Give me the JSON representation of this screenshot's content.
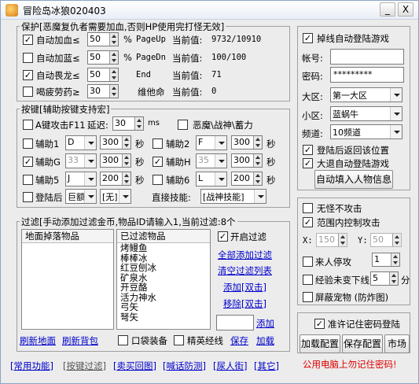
{
  "window": {
    "title": "冒险岛冰狼020403",
    "min_label": "_",
    "close_label": "X"
  },
  "protect": {
    "legend": "保护[恶魔复仇者需要加血,否则HP使用完打怪无效]",
    "rows": [
      {
        "label": "自动加血≤",
        "checked": true,
        "value": "50",
        "pct": "%",
        "key": "PageUp",
        "cur": "当前值:",
        "val": "9732/10910"
      },
      {
        "label": "自动加蓝≤",
        "checked": false,
        "value": "50",
        "pct": "%",
        "key": "PageDn",
        "cur": "当前值:",
        "val": "100/100"
      },
      {
        "label": "自动畏龙≤",
        "checked": true,
        "value": "50",
        "pct": "",
        "key": "End",
        "cur": "当前值:",
        "val": "71"
      },
      {
        "label": "喝疲劳药≥",
        "checked": false,
        "value": "30",
        "pct": "",
        "key": "维他命",
        "cur": "当前值:",
        "val": "0"
      }
    ]
  },
  "keys": {
    "legend": "按键[辅助按键支持宏]",
    "a_attack": "A键攻击F11",
    "delay_label": "延迟:",
    "delay_value": "30",
    "ms": "ms",
    "demon_label": "恶魔\\战神\\蓄力",
    "aux": [
      {
        "label": "辅助1",
        "checked": false,
        "key": "D",
        "val": "300",
        "unit": "秒",
        "enabled": true
      },
      {
        "label": "辅助2",
        "checked": false,
        "key": "F",
        "val": "300",
        "unit": "秒",
        "enabled": true
      },
      {
        "label": "辅助G",
        "checked": true,
        "key": "33",
        "val": "300",
        "unit": "秒",
        "enabled": false
      },
      {
        "label": "辅助H",
        "checked": true,
        "key": "35",
        "val": "300",
        "unit": "秒",
        "enabled": false
      },
      {
        "label": "辅助5",
        "checked": false,
        "key": "J",
        "val": "200",
        "unit": "秒",
        "enabled": true
      },
      {
        "label": "辅助6",
        "checked": false,
        "key": "L",
        "val": "200",
        "unit": "秒",
        "enabled": true
      }
    ],
    "after_login": "登陆后",
    "after_sel1": "巨额",
    "after_sel2": "[无]",
    "direct_skill": "直接技能:",
    "direct_sel": "[战神技能]"
  },
  "filter": {
    "legend": "过滤[手动添加过滤金币,物品ID请输入1,当前过滤:8个",
    "ground_header": "地面掉落物品",
    "filtered_header": "已过滤物品",
    "filtered_items": [
      "烤鳗鱼",
      "棒棒冰",
      "红豆刨冰",
      "矿泉水",
      "开豆酪",
      "活力神水",
      "弓矢",
      "弩矢"
    ],
    "enable_filter": "开启过滤",
    "add_all": "全部添加过滤",
    "clear_list": "清空过滤列表",
    "add_dbl": "添加[双击]",
    "remove_dbl": "移除[双击]",
    "add": "添加",
    "refresh_ground": "刷新地面",
    "refresh_bag": "刷新背包",
    "pocket": "口袋装备",
    "elite": "精英经线",
    "save": "保存",
    "load": "加载"
  },
  "login": {
    "disconnect": "掉线自动登陆游戏",
    "account_label": "帐号:",
    "account_value": "",
    "password_label": "密码:",
    "password_value": "*********",
    "region_label": "大区:",
    "region_value": "第一大区",
    "zone_label": "小区:",
    "zone_value": "蓝蜗牛",
    "channel_label": "频道:",
    "channel_value": "10频道",
    "return_pos": "登陆后返回该位置",
    "quit_login": "大退自动登陆游戏",
    "fill_btn": "自动填入人物信息"
  },
  "attack": {
    "no_attack": "无怪不攻击",
    "range_ctrl": "范围内控制攻击",
    "x_label": "X:",
    "x_value": "150",
    "y_label": "Y:",
    "y_value": "50",
    "stop_on_player": "来人停攻",
    "stop_value": "1",
    "exp_label": "经验未变下线",
    "exp_value": "5",
    "exp_unit": "分",
    "block_pet": "屏蔽宠物 (防炸图)"
  },
  "bottom_right": {
    "remember": "准许记住密码登陆",
    "load_cfg": "加载配置",
    "save_cfg": "保存配置",
    "market": "市场",
    "warning": "公用电脑上勿记住密码!"
  },
  "tabs": [
    "[常用功能]",
    "[按键过滤]",
    "[卖买回图]",
    "[喊话防测]",
    "[尿人街]",
    "[其它]"
  ]
}
